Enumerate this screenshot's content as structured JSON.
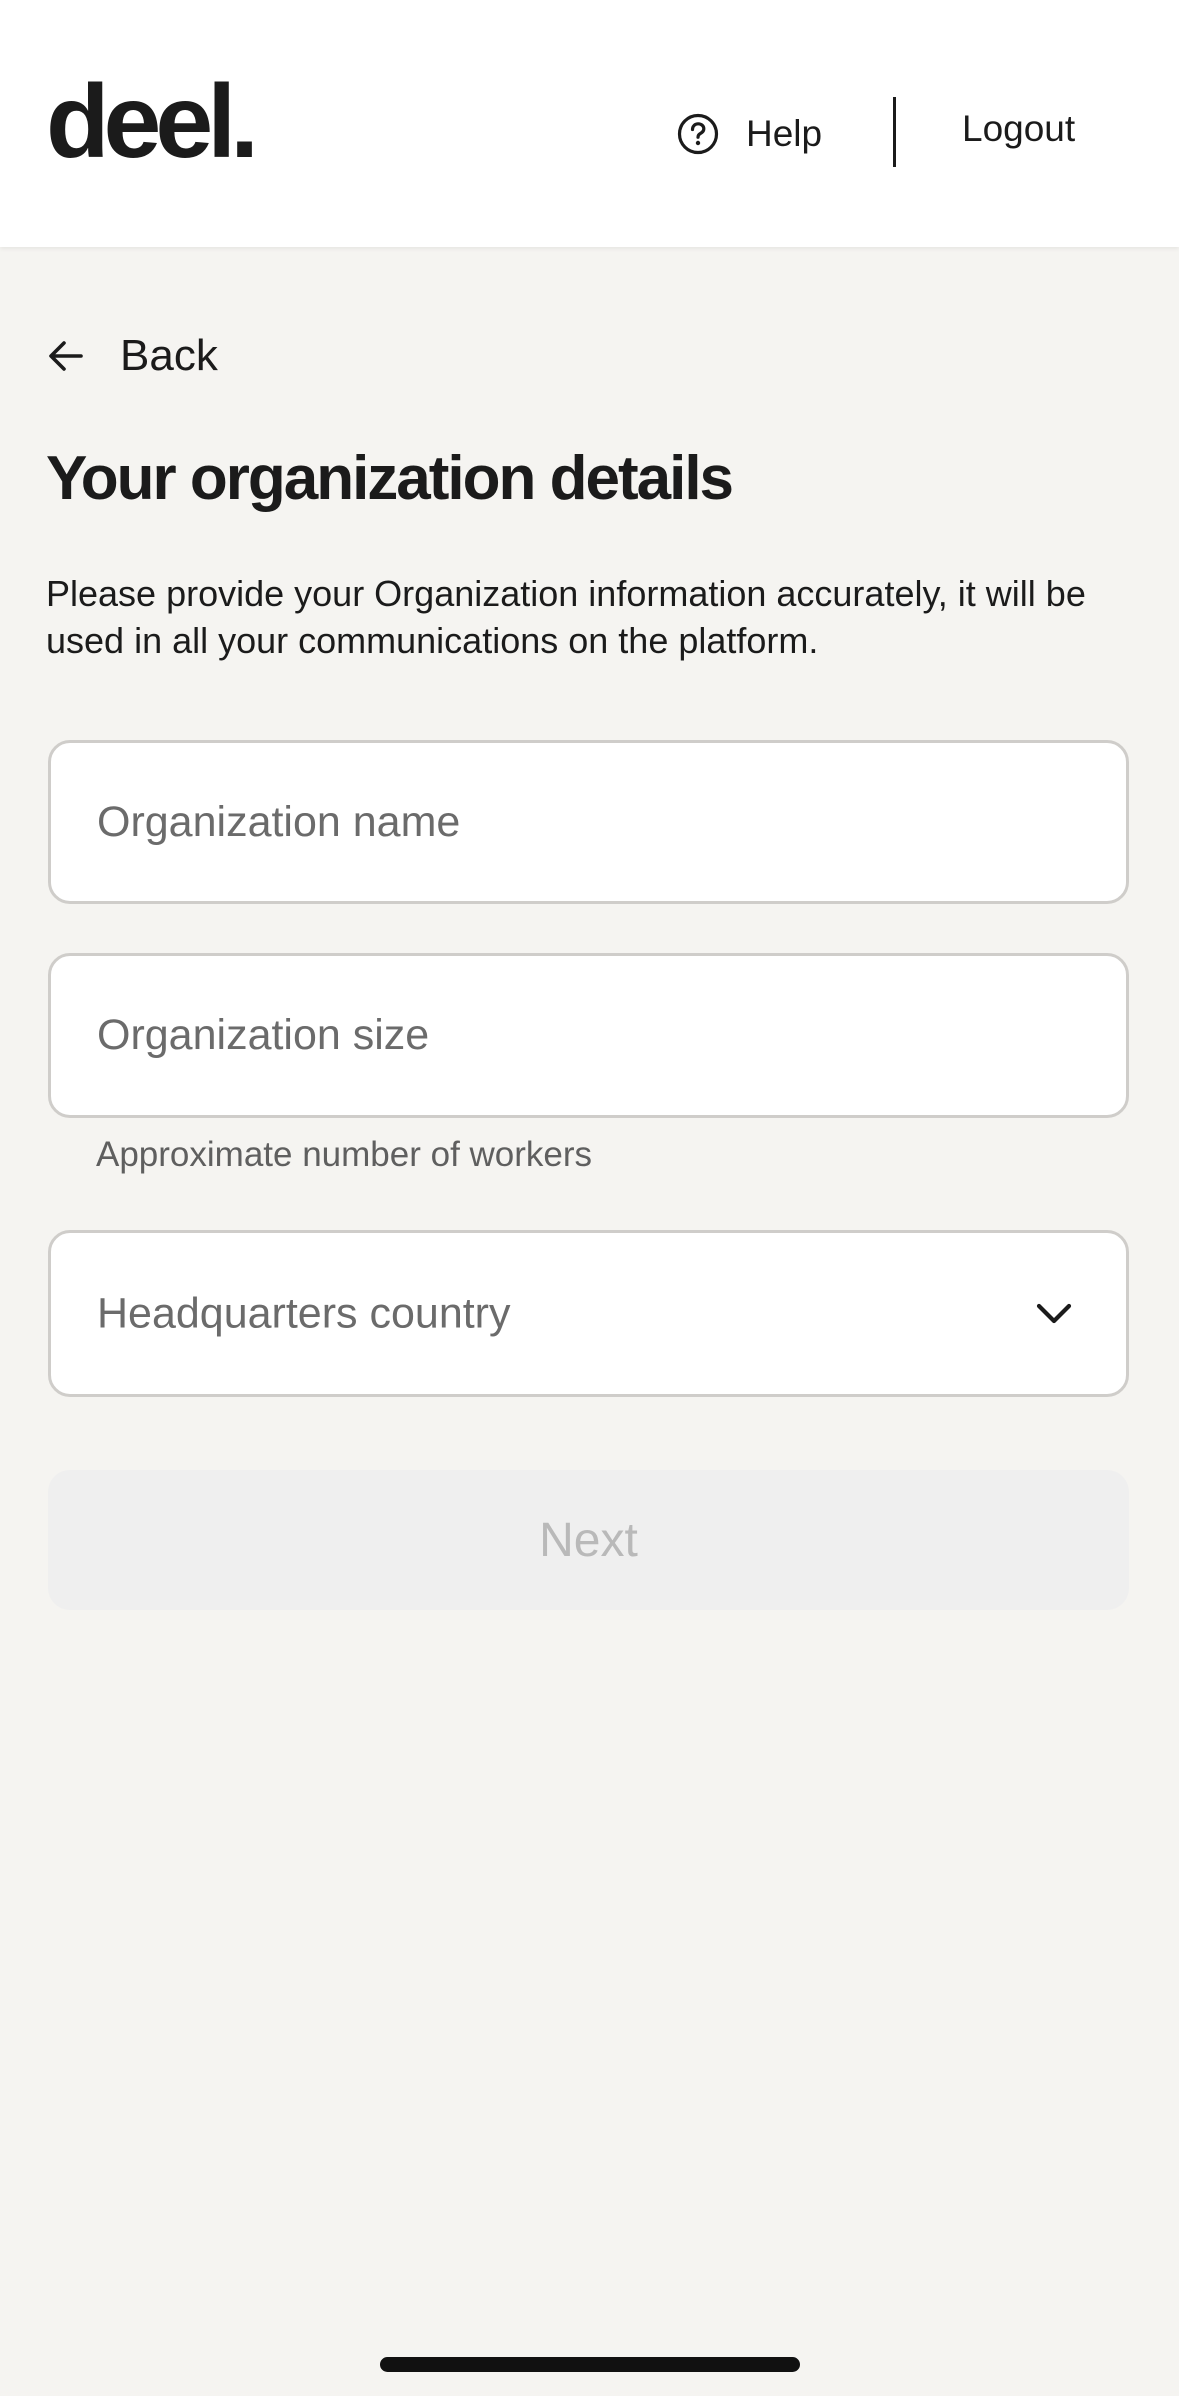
{
  "header": {
    "logo_text": "deel.",
    "help_label": "Help",
    "help_icon": "question-circle-icon",
    "logout_label": "Logout"
  },
  "nav": {
    "back_label": "Back",
    "back_icon": "arrow-left-icon"
  },
  "page": {
    "title": "Your organization details",
    "description": "Please provide your Organization information accurately, it will be used in all your communications on the platform."
  },
  "form": {
    "org_name": {
      "placeholder": "Organization name",
      "value": ""
    },
    "org_size": {
      "placeholder": "Organization size",
      "value": "",
      "hint": "Approximate number of workers"
    },
    "hq_country": {
      "label": "Headquarters country",
      "icon": "chevron-down-icon"
    },
    "next_label": "Next"
  },
  "colors": {
    "background": "#f5f4f1",
    "header_bg": "#ffffff",
    "text": "#1b1b1b",
    "placeholder": "#6b6b6b",
    "disabled_button_bg": "#efefef",
    "disabled_button_text": "#b9b9b9"
  }
}
